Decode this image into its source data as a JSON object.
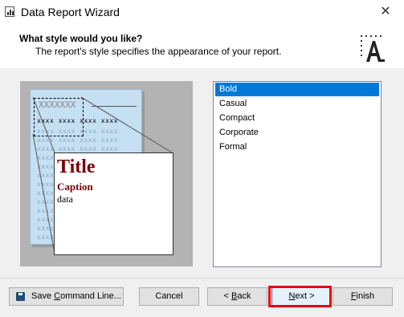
{
  "window": {
    "title": "Data Report Wizard",
    "close_glyph": "✕"
  },
  "header": {
    "title": "What style would you like?",
    "subtitle": "The report's style specifies the appearance of your report."
  },
  "preview": {
    "header_placeholder": "XXXXXXX",
    "row_placeholder_dark": "xxxx  xxxx  xxxx  xxxx",
    "row_placeholder": "xxxx  xxxx  xxxx  xxxx",
    "zoom_title": "Title",
    "zoom_caption": "Caption",
    "zoom_data": "data"
  },
  "styles": {
    "selected": "Bold",
    "items": [
      "Bold",
      "Casual",
      "Compact",
      "Corporate",
      "Formal"
    ]
  },
  "buttons": {
    "save_command_line": {
      "pre": "Save ",
      "u": "C",
      "post": "ommand Line..."
    },
    "cancel": "Cancel",
    "back": {
      "pre": "< ",
      "u": "B",
      "post": "ack"
    },
    "next": {
      "u": "N",
      "post": "ext >"
    },
    "finish": {
      "u": "F",
      "post": "inish"
    }
  },
  "colors": {
    "selection": "#0078d7",
    "highlight_border": "#e30613",
    "title_color": "#7a0000"
  }
}
